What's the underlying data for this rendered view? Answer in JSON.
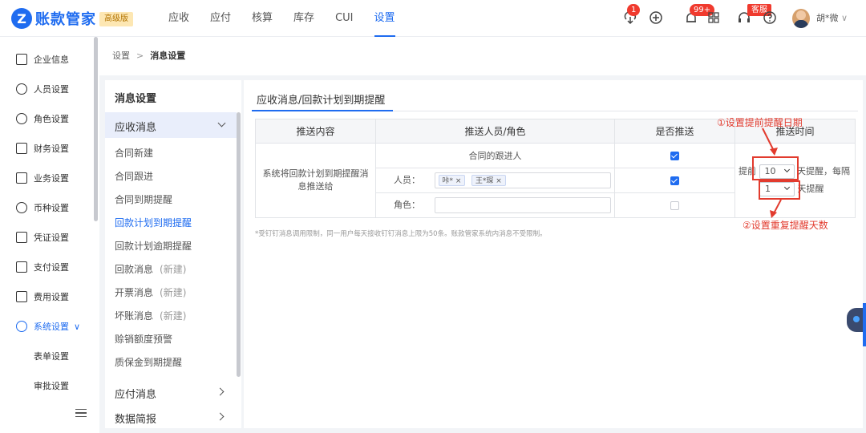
{
  "app": {
    "logo_letter": "Z",
    "name": "账款管家",
    "edition": "高级版"
  },
  "topnav": [
    {
      "label": "应收"
    },
    {
      "label": "应付"
    },
    {
      "label": "核算"
    },
    {
      "label": "库存"
    },
    {
      "label": "CUI"
    },
    {
      "label": "设置",
      "active": true
    }
  ],
  "header_right": {
    "download_badge": "1",
    "notify_badge": "99+",
    "service_badge": "客服",
    "username": "胡*微"
  },
  "sidebar": {
    "items": [
      {
        "label": "企业信息"
      },
      {
        "label": "人员设置"
      },
      {
        "label": "角色设置"
      },
      {
        "label": "财务设置"
      },
      {
        "label": "业务设置"
      },
      {
        "label": "币种设置"
      },
      {
        "label": "凭证设置"
      },
      {
        "label": "支付设置"
      },
      {
        "label": "费用设置"
      },
      {
        "label": "系统设置",
        "active": true
      }
    ],
    "sub_items": [
      {
        "label": "表单设置"
      },
      {
        "label": "审批设置"
      }
    ]
  },
  "breadcrumb": {
    "root": "设置",
    "separator": ">",
    "current": "消息设置"
  },
  "subpanel": {
    "title": "消息设置",
    "group": "应收消息",
    "items": [
      {
        "label": "合同新建",
        "note": ""
      },
      {
        "label": "合同跟进",
        "note": ""
      },
      {
        "label": "合同到期提醒",
        "note": ""
      },
      {
        "label": "回款计划到期提醒",
        "note": "",
        "active": true
      },
      {
        "label": "回款计划逾期提醒",
        "note": ""
      },
      {
        "label": "回款消息",
        "note": "(新建)"
      },
      {
        "label": "开票消息",
        "note": "(新建)"
      },
      {
        "label": "坏账消息",
        "note": "(新建)"
      },
      {
        "label": "赊销额度预警",
        "note": ""
      },
      {
        "label": "质保金到期提醒",
        "note": ""
      }
    ],
    "group2": "应付消息",
    "group3": "数据简报"
  },
  "main": {
    "tab": "应收消息/回款计划到期提醒",
    "columns": [
      "推送内容",
      "推送人员/角色",
      "是否推送",
      "推送时间"
    ],
    "content_text": "系统将回款计划到期提醒消息推送给",
    "row_follow": "合同的跟进人",
    "row_person_label": "人员：",
    "row_person_tags": [
      "咔* ×",
      "王*琛 ×"
    ],
    "row_role_label": "角色：",
    "checks": [
      true,
      true,
      false
    ],
    "time": {
      "prefix": "提前",
      "days_value": "10",
      "mid": "天提醒，每隔",
      "repeat_value": "1",
      "suffix": "天提醒"
    },
    "footnote": "*受钉钉消息调用限制，同一用户每天接收钉钉消息上限为50条。账款管家系统内消息不受限制。"
  },
  "annotations": {
    "top": "①设置提前提醒日期",
    "bottom": "②设置重复提醒天数",
    "color": "#e23b2e"
  }
}
